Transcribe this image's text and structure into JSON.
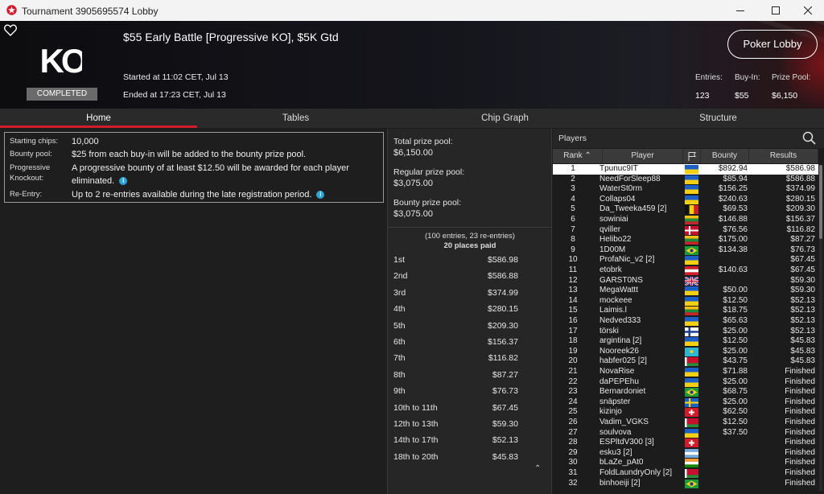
{
  "window": {
    "title": "Tournament 3905695574 Lobby"
  },
  "tournament": {
    "name": "$55 Early Battle [Progressive KO], $5K Gtd",
    "status": "COMPLETED",
    "logo_text": "KO",
    "started": "Started at 11:02 CET, Jul 13",
    "ended": "Ended at 17:23 CET, Jul 13",
    "lobby_button": "Poker Lobby",
    "stats": {
      "entries_label": "Entries:",
      "entries": "123",
      "buyin_label": "Buy-In:",
      "buyin": "$55",
      "prizepool_label": "Prize Pool:",
      "prizepool": "$6,150"
    }
  },
  "tabs": [
    {
      "label": "Home",
      "active": true
    },
    {
      "label": "Tables",
      "active": false
    },
    {
      "label": "Chip Graph",
      "active": false
    },
    {
      "label": "Structure",
      "active": false
    }
  ],
  "info": {
    "starting_label": "Starting chips:",
    "starting": "10,000",
    "bounty_label": "Bounty pool:",
    "bounty": "$25 from each buy-in will be added to the bounty prize pool.",
    "pko_label": "Progressive Knockout:",
    "pko": "A progressive bounty of at least $12.50 will be awarded for each player eliminated.",
    "reentry_label": "Re-Entry:",
    "reentry": "Up to 2 re-entries available during the late registration period."
  },
  "prizes": {
    "total_label": "Total prize pool:",
    "total": "$6,150.00",
    "regular_label": "Regular prize pool:",
    "regular": "$3,075.00",
    "bounty_label": "Bounty prize pool:",
    "bounty": "$3,075.00",
    "entries_note": "(100 entries, 23 re-entries)",
    "places_paid": "20 places paid",
    "payouts": [
      {
        "place": "1st",
        "amount": "$586.98"
      },
      {
        "place": "2nd",
        "amount": "$586.88"
      },
      {
        "place": "3rd",
        "amount": "$374.99"
      },
      {
        "place": "4th",
        "amount": "$280.15"
      },
      {
        "place": "5th",
        "amount": "$209.30"
      },
      {
        "place": "6th",
        "amount": "$156.37"
      },
      {
        "place": "7th",
        "amount": "$116.82"
      },
      {
        "place": "8th",
        "amount": "$87.27"
      },
      {
        "place": "9th",
        "amount": "$76.73"
      },
      {
        "place": "10th to 11th",
        "amount": "$67.45"
      },
      {
        "place": "12th to 13th",
        "amount": "$59.30"
      },
      {
        "place": "14th to 17th",
        "amount": "$52.13"
      },
      {
        "place": "18th to 20th",
        "amount": "$45.83"
      }
    ]
  },
  "players": {
    "title": "Players",
    "columns": {
      "rank": "Rank",
      "player": "Player",
      "bounty": "Bounty",
      "results": "Results"
    },
    "rows": [
      {
        "rank": "1",
        "name": "Tpunuc9IT",
        "flag": "ua",
        "bounty": "$892.94",
        "result": "$586.98"
      },
      {
        "rank": "2",
        "name": "NeedForSleep88",
        "flag": "ua",
        "bounty": "$85.94",
        "result": "$586.88"
      },
      {
        "rank": "3",
        "name": "WaterSt0rm",
        "flag": "ua",
        "bounty": "$156.25",
        "result": "$374.99"
      },
      {
        "rank": "4",
        "name": "Collaps04",
        "flag": "ua",
        "bounty": "$240.63",
        "result": "$280.15"
      },
      {
        "rank": "5",
        "name": "Da_Tweeka459 [2]",
        "flag": "be",
        "bounty": "$69.53",
        "result": "$209.30"
      },
      {
        "rank": "6",
        "name": "sowiniai",
        "flag": "lt",
        "bounty": "$146.88",
        "result": "$156.37"
      },
      {
        "rank": "7",
        "name": "qviller",
        "flag": "dk",
        "bounty": "$76.56",
        "result": "$116.82"
      },
      {
        "rank": "8",
        "name": "Helibo22",
        "flag": "lt",
        "bounty": "$175.00",
        "result": "$87.27"
      },
      {
        "rank": "9",
        "name": "1D00M",
        "flag": "br",
        "bounty": "$134.38",
        "result": "$76.73"
      },
      {
        "rank": "10",
        "name": "ProfaNic_v2 [2]",
        "flag": "ua",
        "bounty": "",
        "result": "$67.45"
      },
      {
        "rank": "11",
        "name": "etobrk",
        "flag": "at",
        "bounty": "$140.63",
        "result": "$67.45"
      },
      {
        "rank": "12",
        "name": "GARST0NS",
        "flag": "gb",
        "bounty": "",
        "result": "$59.30"
      },
      {
        "rank": "13",
        "name": "MegaWattt",
        "flag": "ua",
        "bounty": "$50.00",
        "result": "$59.30"
      },
      {
        "rank": "14",
        "name": "mockeee",
        "flag": "ua",
        "bounty": "$12.50",
        "result": "$52.13"
      },
      {
        "rank": "15",
        "name": "Laimis.l",
        "flag": "lt",
        "bounty": "$18.75",
        "result": "$52.13"
      },
      {
        "rank": "16",
        "name": "Nedved333",
        "flag": "ua",
        "bounty": "$65.63",
        "result": "$52.13"
      },
      {
        "rank": "17",
        "name": "törski",
        "flag": "fi",
        "bounty": "$25.00",
        "result": "$52.13"
      },
      {
        "rank": "18",
        "name": "argintina [2]",
        "flag": "ua",
        "bounty": "$12.50",
        "result": "$45.83"
      },
      {
        "rank": "19",
        "name": "Nooreek26",
        "flag": "kz",
        "bounty": "$25.00",
        "result": "$45.83"
      },
      {
        "rank": "20",
        "name": "habfer025 [2]",
        "flag": "by",
        "bounty": "$43.75",
        "result": "$45.83"
      },
      {
        "rank": "21",
        "name": "NovaRise",
        "flag": "ua",
        "bounty": "$71.88",
        "result": "Finished"
      },
      {
        "rank": "22",
        "name": "daPEPEhu",
        "flag": "ua",
        "bounty": "$25.00",
        "result": "Finished"
      },
      {
        "rank": "23",
        "name": "Bernardoniet",
        "flag": "br",
        "bounty": "$68.75",
        "result": "Finished"
      },
      {
        "rank": "24",
        "name": "snäpster",
        "flag": "se",
        "bounty": "$25.00",
        "result": "Finished"
      },
      {
        "rank": "25",
        "name": "kizinjo",
        "flag": "ch",
        "bounty": "$62.50",
        "result": "Finished"
      },
      {
        "rank": "26",
        "name": "Vadim_VGKS",
        "flag": "by",
        "bounty": "$12.50",
        "result": "Finished"
      },
      {
        "rank": "27",
        "name": "soulvova",
        "flag": "ua",
        "bounty": "$37.50",
        "result": "Finished"
      },
      {
        "rank": "28",
        "name": "ESPltdV300 [3]",
        "flag": "ch",
        "bounty": "",
        "result": "Finished"
      },
      {
        "rank": "29",
        "name": "esku3 [2]",
        "flag": "ar",
        "bounty": "",
        "result": "Finished"
      },
      {
        "rank": "30",
        "name": "bLaZe_pAt0",
        "flag": "in",
        "bounty": "",
        "result": "Finished"
      },
      {
        "rank": "31",
        "name": "FoldLaundryOnly [2]",
        "flag": "by",
        "bounty": "",
        "result": "Finished"
      },
      {
        "rank": "32",
        "name": "binhoeiji [2]",
        "flag": "br",
        "bounty": "",
        "result": "Finished"
      }
    ]
  },
  "colors": {
    "accent": "#d21b2b",
    "info_icon": "#2aa5d8"
  }
}
